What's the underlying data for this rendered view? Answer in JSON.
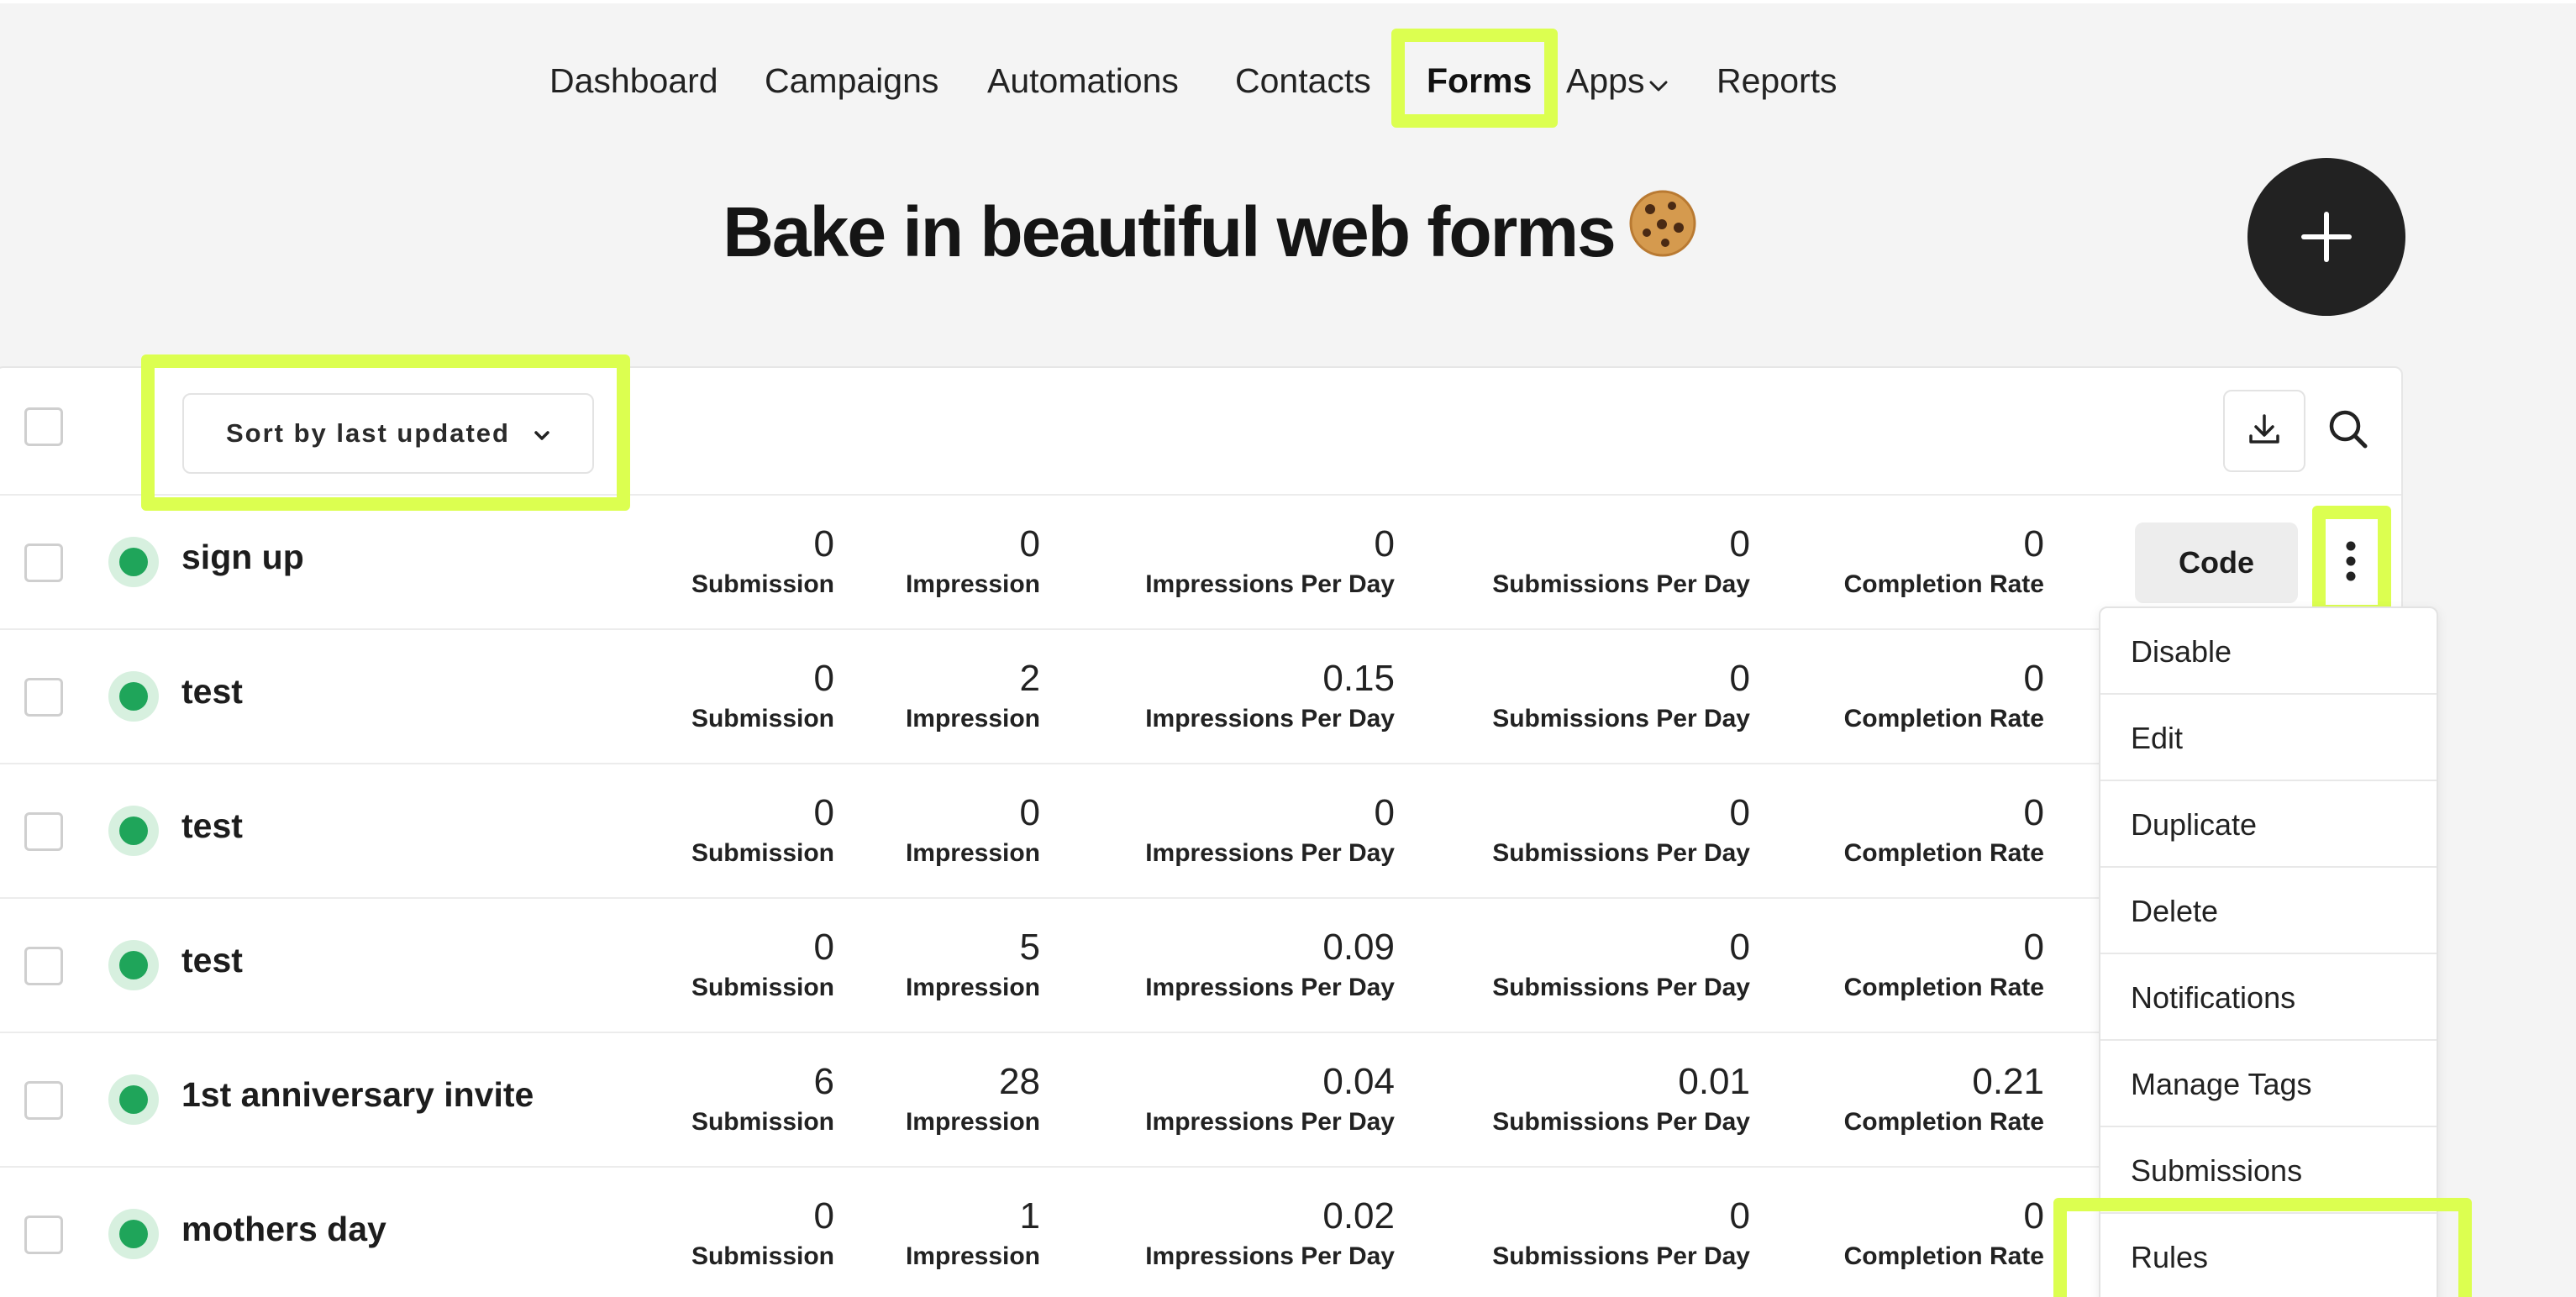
{
  "nav": {
    "items": [
      {
        "label": "Dashboard"
      },
      {
        "label": "Campaigns"
      },
      {
        "label": "Automations"
      },
      {
        "label": "Contacts"
      },
      {
        "label": "Forms"
      },
      {
        "label": "Apps"
      },
      {
        "label": "Reports"
      }
    ],
    "active": "Forms"
  },
  "hero": {
    "title": "Bake in beautiful web forms",
    "emoji_icon": "cookie-icon"
  },
  "toolbar": {
    "sort_label": "Sort by last updated",
    "icons": [
      "download-icon",
      "search-icon"
    ]
  },
  "stat_labels": {
    "submission": "Submission",
    "impression": "Impression",
    "impressions_per_day": "Impressions Per Day",
    "submissions_per_day": "Submissions Per Day",
    "completion_rate": "Completion Rate"
  },
  "forms": [
    {
      "name": "sign up",
      "submission": "0",
      "impression": "0",
      "impressions_per_day": "0",
      "submissions_per_day": "0",
      "completion_rate": "0"
    },
    {
      "name": "test",
      "submission": "0",
      "impression": "2",
      "impressions_per_day": "0.15",
      "submissions_per_day": "0",
      "completion_rate": "0"
    },
    {
      "name": "test",
      "submission": "0",
      "impression": "0",
      "impressions_per_day": "0",
      "submissions_per_day": "0",
      "completion_rate": "0"
    },
    {
      "name": "test",
      "submission": "0",
      "impression": "5",
      "impressions_per_day": "0.09",
      "submissions_per_day": "0",
      "completion_rate": "0"
    },
    {
      "name": "1st anniversary invite",
      "submission": "6",
      "impression": "28",
      "impressions_per_day": "0.04",
      "submissions_per_day": "0.01",
      "completion_rate": "0.21"
    },
    {
      "name": "mothers day",
      "submission": "0",
      "impression": "1",
      "impressions_per_day": "0.02",
      "submissions_per_day": "0",
      "completion_rate": "0"
    }
  ],
  "row_actions": {
    "code_label": "Code"
  },
  "menu": {
    "items": [
      {
        "label": "Disable"
      },
      {
        "label": "Edit"
      },
      {
        "label": "Duplicate"
      },
      {
        "label": "Delete"
      },
      {
        "label": "Notifications"
      },
      {
        "label": "Manage Tags"
      },
      {
        "label": "Submissions"
      },
      {
        "label": "Rules"
      }
    ]
  },
  "colors": {
    "highlight": "#dcff50",
    "status_active": "#1fa55a",
    "fab": "#222222"
  }
}
